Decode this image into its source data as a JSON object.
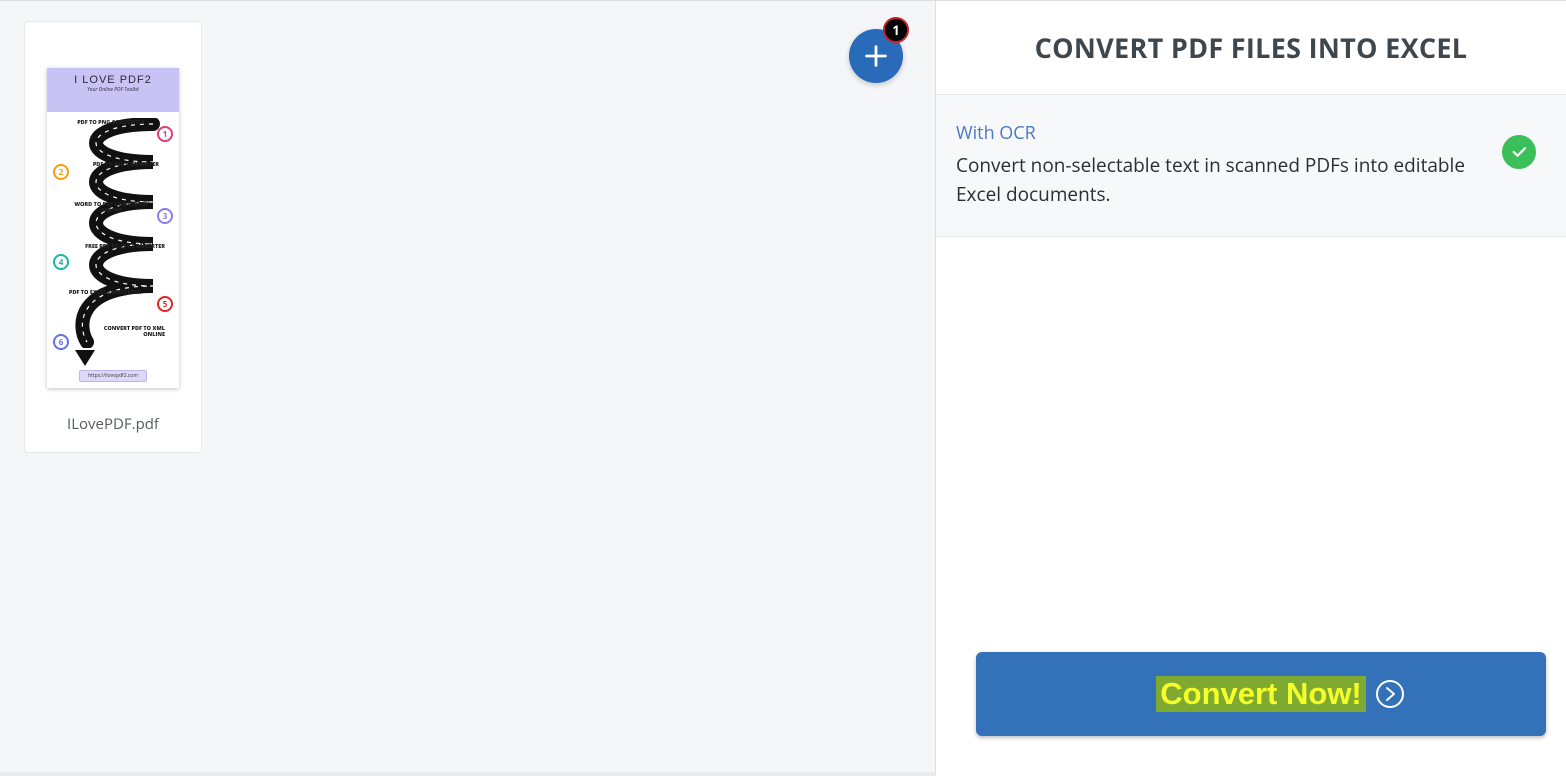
{
  "panel": {
    "title": "CONVERT PDF FILES INTO EXCEL"
  },
  "file": {
    "name": "ILovePDF.pdf",
    "badge_count": "1",
    "thumb_title": "I LOVE PDF2",
    "thumb_subtitle": "Your Online PDF Toolkit",
    "thumb_url_pill": "https://ilovepdf2.com",
    "steps": [
      {
        "n": "1",
        "label": "PDF TO PNG CONVERTER"
      },
      {
        "n": "2",
        "label": "PDF TO PSD CONVERTER"
      },
      {
        "n": "3",
        "label": "WORD TO PDF CONVERTER ONLINE"
      },
      {
        "n": "4",
        "label": "FREE PDF TO PPT CONVERTER"
      },
      {
        "n": "5",
        "label": "PDF TO EXCEL CONVERTER"
      },
      {
        "n": "6",
        "label": "CONVERT PDF TO XML ONLINE"
      }
    ]
  },
  "option_ocr": {
    "heading": "With OCR",
    "description": "Convert non-selectable text in scanned PDFs into editable Excel documents."
  },
  "actions": {
    "convert_label": "Convert Now!"
  }
}
